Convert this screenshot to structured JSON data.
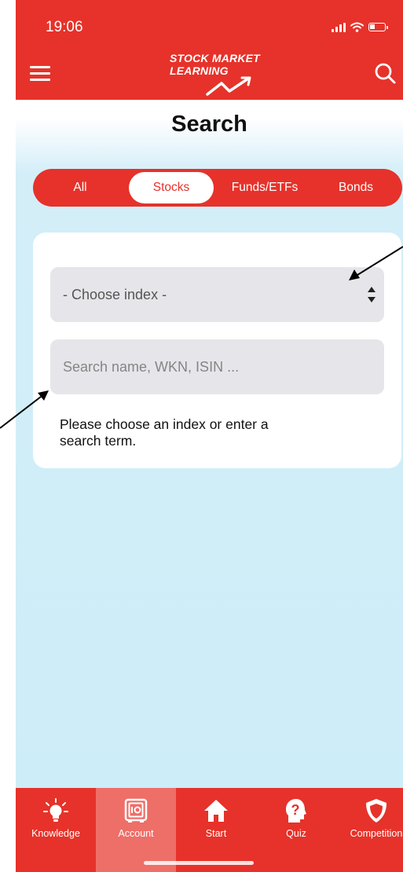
{
  "status_bar": {
    "time": "19:06"
  },
  "header": {
    "logo_line1": "STOCK MARKET",
    "logo_line2": "LEARNING"
  },
  "page": {
    "title": "Search"
  },
  "segments": {
    "all": "All",
    "stocks": "Stocks",
    "funds": "Funds/ETFs",
    "bonds": "Bonds",
    "selected": "Stocks"
  },
  "search_card": {
    "index_select": "- Choose index -",
    "search_placeholder": "Search name, WKN, ISIN ...",
    "hint": "Please choose an index or enter a search term."
  },
  "tab_bar": {
    "knowledge": "Knowledge",
    "account": "Account",
    "start": "Start",
    "quiz": "Quiz",
    "competition": "Competition",
    "selected": "Account"
  },
  "colors": {
    "brand_red": "#e6322a",
    "background": "#cdedf8",
    "card": "#ffffff",
    "field": "#e6e6ea"
  },
  "icons": [
    "menu-icon",
    "search-icon",
    "lightbulb-icon",
    "safe-icon",
    "home-icon",
    "question-head-icon",
    "shield-icon",
    "signal-icon",
    "wifi-icon",
    "battery-icon",
    "chart-arrow-icon"
  ]
}
